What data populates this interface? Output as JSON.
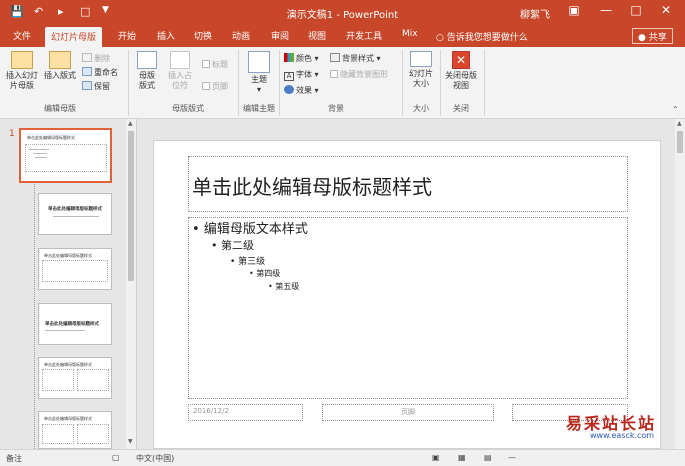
{
  "window": {
    "doc_title": "演示文稿1 - PowerPoint",
    "user": "柳絮飞"
  },
  "tabs": [
    "文件",
    "幻灯片母版",
    "开始",
    "插入",
    "切换",
    "动画",
    "审阅",
    "视图",
    "开发工具",
    "Mix"
  ],
  "tell_me": "告诉我您想要做什么",
  "share": "共享",
  "ribbon": {
    "insert_master": "插入幻灯片母版",
    "insert_layout": "插入版式",
    "delete": "删除",
    "rename": "重命名",
    "preserve": "保留",
    "group_edit_master": "编辑母版",
    "master_layout": "母版版式",
    "insert_placeholder": "插入占位符",
    "title_chk": "标题",
    "footer_chk": "页脚",
    "group_master_layout": "母版版式",
    "themes": "主题",
    "group_edit_theme": "编辑主题",
    "colors": "颜色",
    "fonts": "字体",
    "effects": "效果",
    "bg_styles": "背景样式",
    "hide_bg": "隐藏背景图形",
    "group_background": "背景",
    "slide_size": "幻灯片大小",
    "group_size": "大小",
    "close_master": "关闭母版视图",
    "group_close": "关闭"
  },
  "thumbs": {
    "slide_number": "1",
    "t1_title": "单击此处编辑母版标题样式",
    "t2_title": "单击此处编辑母版标题样式",
    "t3_title": "单击此处编辑母版标题样式",
    "t4_title": "单击此处编辑母版标题样式",
    "t5_title": "单击此处编辑母版标题样式",
    "t6_title": "单击此处编辑母版标题样式"
  },
  "slide": {
    "title": "单击此处编辑母版标题样式",
    "levels": [
      "编辑母版文本样式",
      "第二级",
      "第三级",
      "第四级",
      "第五级"
    ],
    "footer_date": "2016/12/2",
    "footer_center": "页脚"
  },
  "status": {
    "notes": "备注",
    "lang": "中文(中国)"
  },
  "watermark": {
    "text": "易采站长站",
    "url": "www.easck.com"
  },
  "colors": {
    "accent": "#c8472a",
    "ribbon_bg": "#f3f3f3",
    "workspace_bg": "#e6e6e6"
  }
}
